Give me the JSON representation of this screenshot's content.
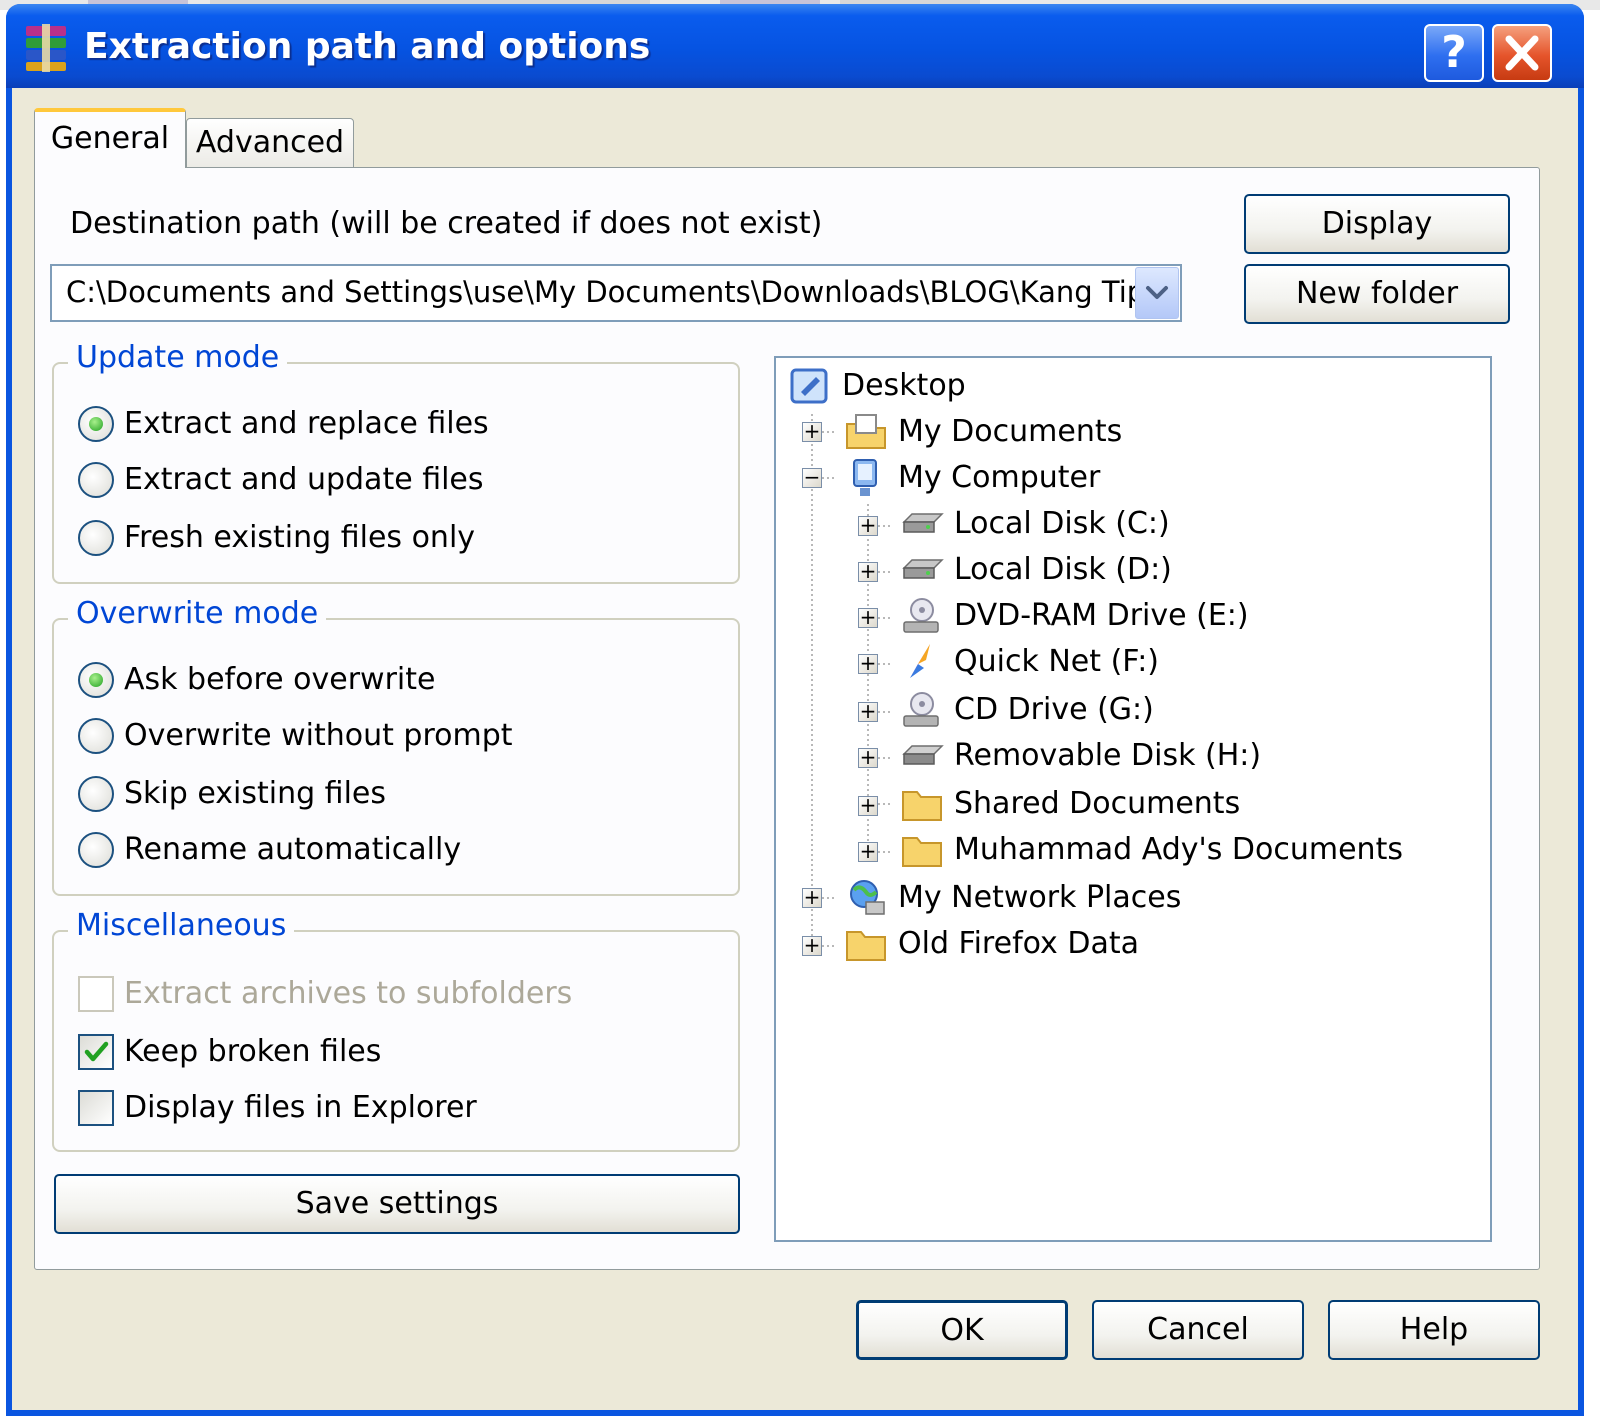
{
  "window": {
    "title": "Extraction path and options"
  },
  "tabs": [
    {
      "label": "General"
    },
    {
      "label": "Advanced"
    }
  ],
  "destination": {
    "label": "Destination path (will be created if does not exist)",
    "value": "C:\\Documents and Settings\\use\\My Documents\\Downloads\\BLOG\\Kang Tips"
  },
  "buttons": {
    "display": "Display",
    "new_folder": "New folder",
    "save_settings": "Save settings",
    "ok": "OK",
    "cancel": "Cancel",
    "help": "Help"
  },
  "update_mode": {
    "legend": "Update mode",
    "options": [
      {
        "label": "Extract and replace files",
        "selected": true
      },
      {
        "label": "Extract and update files",
        "selected": false
      },
      {
        "label": "Fresh existing files only",
        "selected": false
      }
    ]
  },
  "overwrite_mode": {
    "legend": "Overwrite mode",
    "options": [
      {
        "label": "Ask before overwrite",
        "selected": true
      },
      {
        "label": "Overwrite without prompt",
        "selected": false
      },
      {
        "label": "Skip existing files",
        "selected": false
      },
      {
        "label": "Rename automatically",
        "selected": false
      }
    ]
  },
  "misc": {
    "legend": "Miscellaneous",
    "options": [
      {
        "label": "Extract archives to subfolders",
        "checked": false,
        "disabled": true
      },
      {
        "label": "Keep broken files",
        "checked": true,
        "disabled": false
      },
      {
        "label": "Display files in Explorer",
        "checked": false,
        "disabled": false
      }
    ]
  },
  "tree": {
    "nodes": [
      {
        "label": "Desktop",
        "icon": "desktop-icon",
        "level": 0
      },
      {
        "label": "My Documents",
        "icon": "my-documents-icon",
        "level": 1,
        "expander": "+"
      },
      {
        "label": "My Computer",
        "icon": "my-computer-icon",
        "level": 1,
        "expander": "−"
      },
      {
        "label": "Local Disk (C:)",
        "icon": "hard-drive-icon",
        "level": 2,
        "expander": "+"
      },
      {
        "label": "Local Disk (D:)",
        "icon": "hard-drive-icon",
        "level": 2,
        "expander": "+"
      },
      {
        "label": "DVD-RAM Drive (E:)",
        "icon": "dvd-drive-icon",
        "level": 2,
        "expander": "+"
      },
      {
        "label": "Quick Net (F:)",
        "icon": "quick-net-icon",
        "level": 2,
        "expander": "+"
      },
      {
        "label": "CD Drive (G:)",
        "icon": "cd-drive-icon",
        "level": 2,
        "expander": "+"
      },
      {
        "label": "Removable Disk (H:)",
        "icon": "removable-disk-icon",
        "level": 2,
        "expander": "+"
      },
      {
        "label": "Shared Documents",
        "icon": "folder-icon",
        "level": 2,
        "expander": "+"
      },
      {
        "label": "Muhammad Ady's Documents",
        "icon": "folder-icon",
        "level": 2,
        "expander": "+"
      },
      {
        "label": "My Network Places",
        "icon": "network-places-icon",
        "level": 1,
        "expander": "+"
      },
      {
        "label": "Old Firefox Data",
        "icon": "folder-icon",
        "level": 1,
        "expander": "+"
      }
    ]
  },
  "colors": {
    "title_bar": "#0a55e0",
    "group_legend": "#0046d5",
    "dialog_bg": "#ece9d8",
    "active_tab_accent": "#ffc83c"
  }
}
